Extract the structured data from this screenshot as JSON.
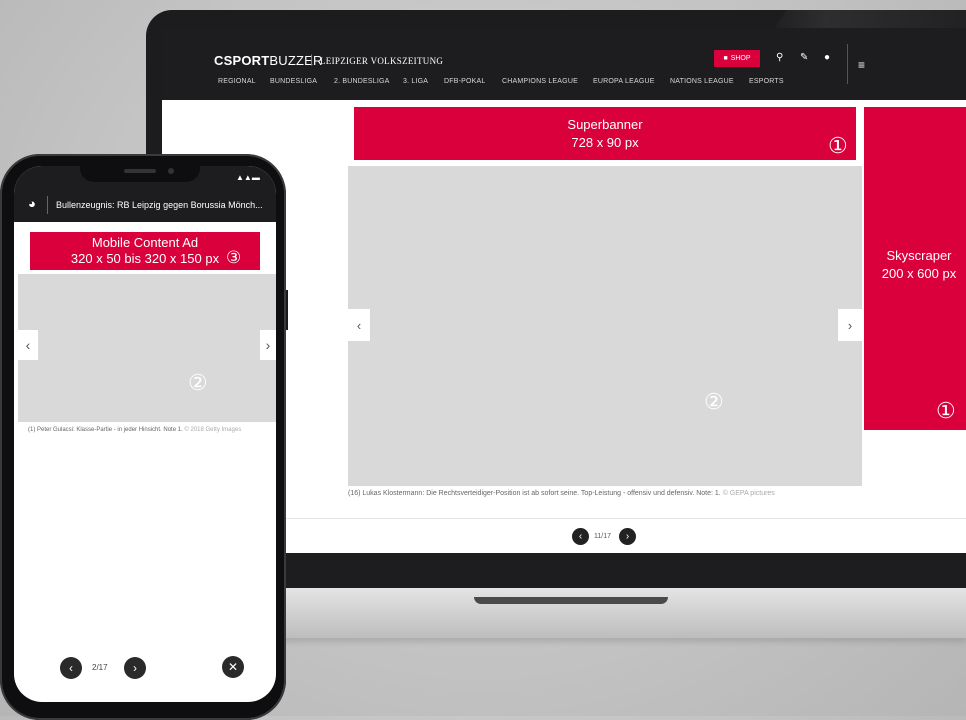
{
  "desktop": {
    "brand": {
      "logo_mark": "C",
      "sportbuzzer_bold": "SPORT",
      "sportbuzzer_light": "BUZZER",
      "separator": "|",
      "partner": "LEIPZIGER VOLKSZEITUNG"
    },
    "nav": [
      "REGIONAL",
      "BUNDESLIGA",
      "2. BUNDESLIGA",
      "3. LIGA",
      "DFB-POKAL",
      "CHAMPIONS LEAGUE",
      "EUROPA LEAGUE",
      "NATIONS LEAGUE",
      "ESPORTS"
    ],
    "shop_label": "SHOP",
    "icons": [
      "shirt-icon",
      "search-icon",
      "pencil-icon",
      "user-icon",
      "menu-icon"
    ],
    "superbanner": {
      "title": "Superbanner",
      "size": "728 x 90 px",
      "marker": "①"
    },
    "skyscraper": {
      "title": "Skyscraper",
      "size": "200 x 600 px",
      "marker": "①"
    },
    "gallery": {
      "marker": "②",
      "prev": "‹",
      "next": "›",
      "caption": "(16) Lukas Klostermann: Die Rechtsverteidiger-Position ist ab sofort seine. Top-Leistung - offensiv und defensiv. Note: 1.",
      "credit": "© GEPA pictures",
      "pager": "11/17"
    }
  },
  "mobile": {
    "title": "Bullenzeugnis: RB Leipzig gegen Borussia Mönch...",
    "content_ad": {
      "title": "Mobile Content Ad",
      "size": "320 x 50 bis 320 x 150 px",
      "marker": "③"
    },
    "gallery": {
      "marker": "②",
      "prev": "‹",
      "next": "›",
      "caption": "(1) Peter Gulacsi: Klasse-Partie - in jeder Hinsicht. Note 1.",
      "credit": "© 2018 Getty Images",
      "pager": "2/17",
      "close": "✕"
    }
  },
  "colors": {
    "accent": "#d9003b",
    "header": "#1d1d1f",
    "gallery_bg": "#d9d9d9"
  }
}
